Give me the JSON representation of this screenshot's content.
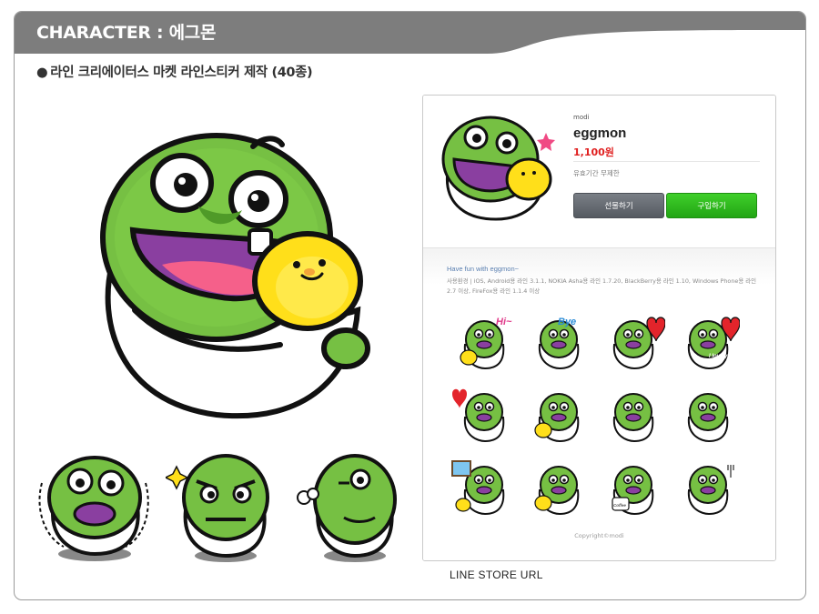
{
  "header": {
    "title": "CHARACTER : 에그몬"
  },
  "subtitle": {
    "bullet": "●",
    "text": "라인 크리에이터스 마켓 라인스티커 제작 (40종)"
  },
  "store": {
    "seller": "modi",
    "name": "eggmon",
    "price": "1,100원",
    "validity": "유효기간 무제한",
    "gift_label": "선물하기",
    "buy_label": "구입하기",
    "fun_text": "Have fun with eggmon~",
    "env_text": "사용환경  |  iOS, Android용 라인 3.1.1, NOKIA Asha용 라인 1.7.20, BlackBerry용 라인 1.10, Windows Phone용 라인 2.7 이상, FireFox용 라인 1.1.4 이상",
    "copyright": "Copyright©modi",
    "stickers": [
      {
        "name": "hi",
        "text": "Hi~"
      },
      {
        "name": "bye",
        "text": "Bye"
      },
      {
        "name": "heart",
        "text": ""
      },
      {
        "name": "i-love-you",
        "text": "I love you"
      },
      {
        "name": "broken-heart",
        "text": ""
      },
      {
        "name": "surprised",
        "text": ""
      },
      {
        "name": "tongue",
        "text": ""
      },
      {
        "name": "grin",
        "text": ""
      },
      {
        "name": "window",
        "text": ""
      },
      {
        "name": "party",
        "text": ""
      },
      {
        "name": "coffee",
        "text": "Coffee"
      },
      {
        "name": "meal",
        "text": ""
      }
    ]
  },
  "caption": "LINE STORE URL",
  "colors": {
    "header": "#7f7f7f",
    "green": "#76c043",
    "dark_green": "#3f8c1f",
    "price": "#e02020",
    "buy": "#2bb51b"
  }
}
